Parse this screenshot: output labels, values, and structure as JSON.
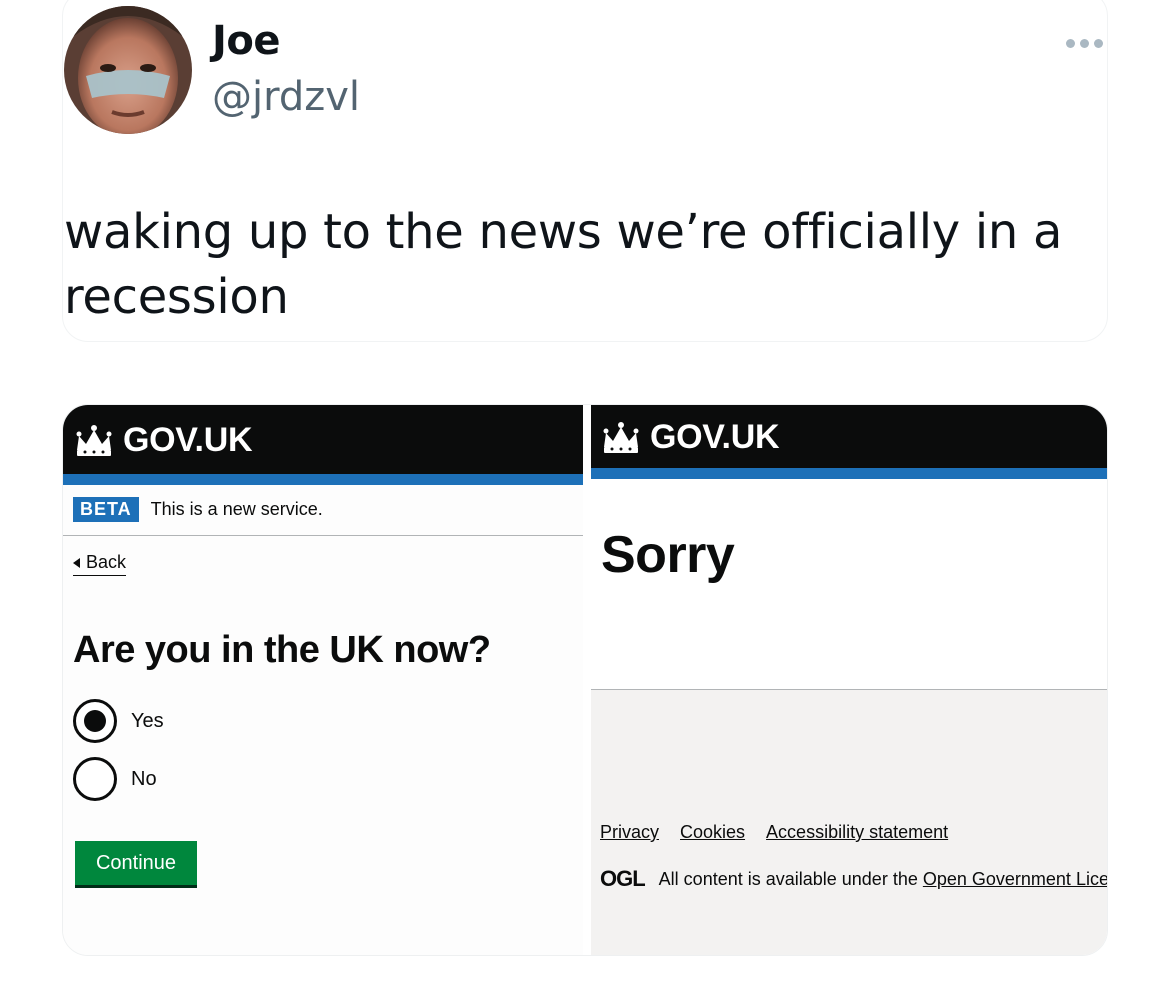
{
  "tweet": {
    "display_name": "Joe",
    "handle": "@jrdzvl",
    "text": "waking up to the news we’re officially in a recession"
  },
  "left_panel": {
    "logo_text": "GOV.UK",
    "phase_tag": "BETA",
    "phase_text": "This is a new service.",
    "back_label": "Back",
    "question": "Are you in the UK now?",
    "options": [
      {
        "label": "Yes",
        "checked": true
      },
      {
        "label": "No",
        "checked": false
      }
    ],
    "continue_label": "Continue"
  },
  "right_panel": {
    "logo_text": "GOV.UK",
    "heading": "Sorry",
    "footer_links": [
      "Privacy",
      "Cookies",
      "Accessibility statement"
    ],
    "ogl_label": "OGL",
    "licence_text": "All content is available under the",
    "licence_link": "Open Government Lice"
  },
  "colors": {
    "govuk_black": "#0b0c0c",
    "govuk_blue": "#1d70b8",
    "govuk_green": "#00873d",
    "footer_grey": "#f3f2f1",
    "handle_grey": "#536471"
  },
  "icons": [
    "more-icon",
    "crown-icon",
    "back-chevron-icon",
    "radio-checked-icon",
    "radio-unchecked-icon"
  ]
}
